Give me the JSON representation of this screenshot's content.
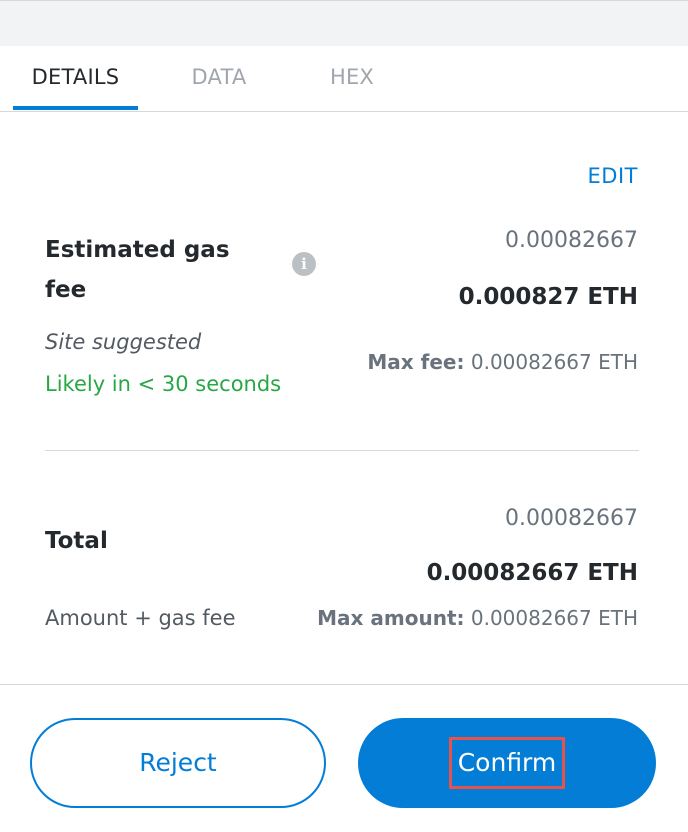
{
  "tabs": [
    {
      "label": "DETAILS",
      "active": true
    },
    {
      "label": "DATA",
      "active": false
    },
    {
      "label": "HEX",
      "active": false
    }
  ],
  "edit_label": "EDIT",
  "gas": {
    "title": "Estimated gas fee",
    "info_icon": "info-icon",
    "secondary_value": "0.00082667",
    "primary_value": "0.000827 ETH",
    "site_suggested": "Site suggested",
    "likely": "Likely in < 30 seconds",
    "max_fee_label": "Max fee:",
    "max_fee_value": "0.00082667 ETH"
  },
  "total": {
    "title": "Total",
    "secondary_value": "0.00082667",
    "primary_value": "0.00082667 ETH",
    "description": "Amount + gas fee",
    "max_amount_label": "Max amount:",
    "max_amount_value": "0.00082667 ETH"
  },
  "buttons": {
    "reject": "Reject",
    "confirm": "Confirm"
  },
  "colors": {
    "accent": "#037dd6",
    "success": "#28a745",
    "highlight": "#e5534b"
  }
}
